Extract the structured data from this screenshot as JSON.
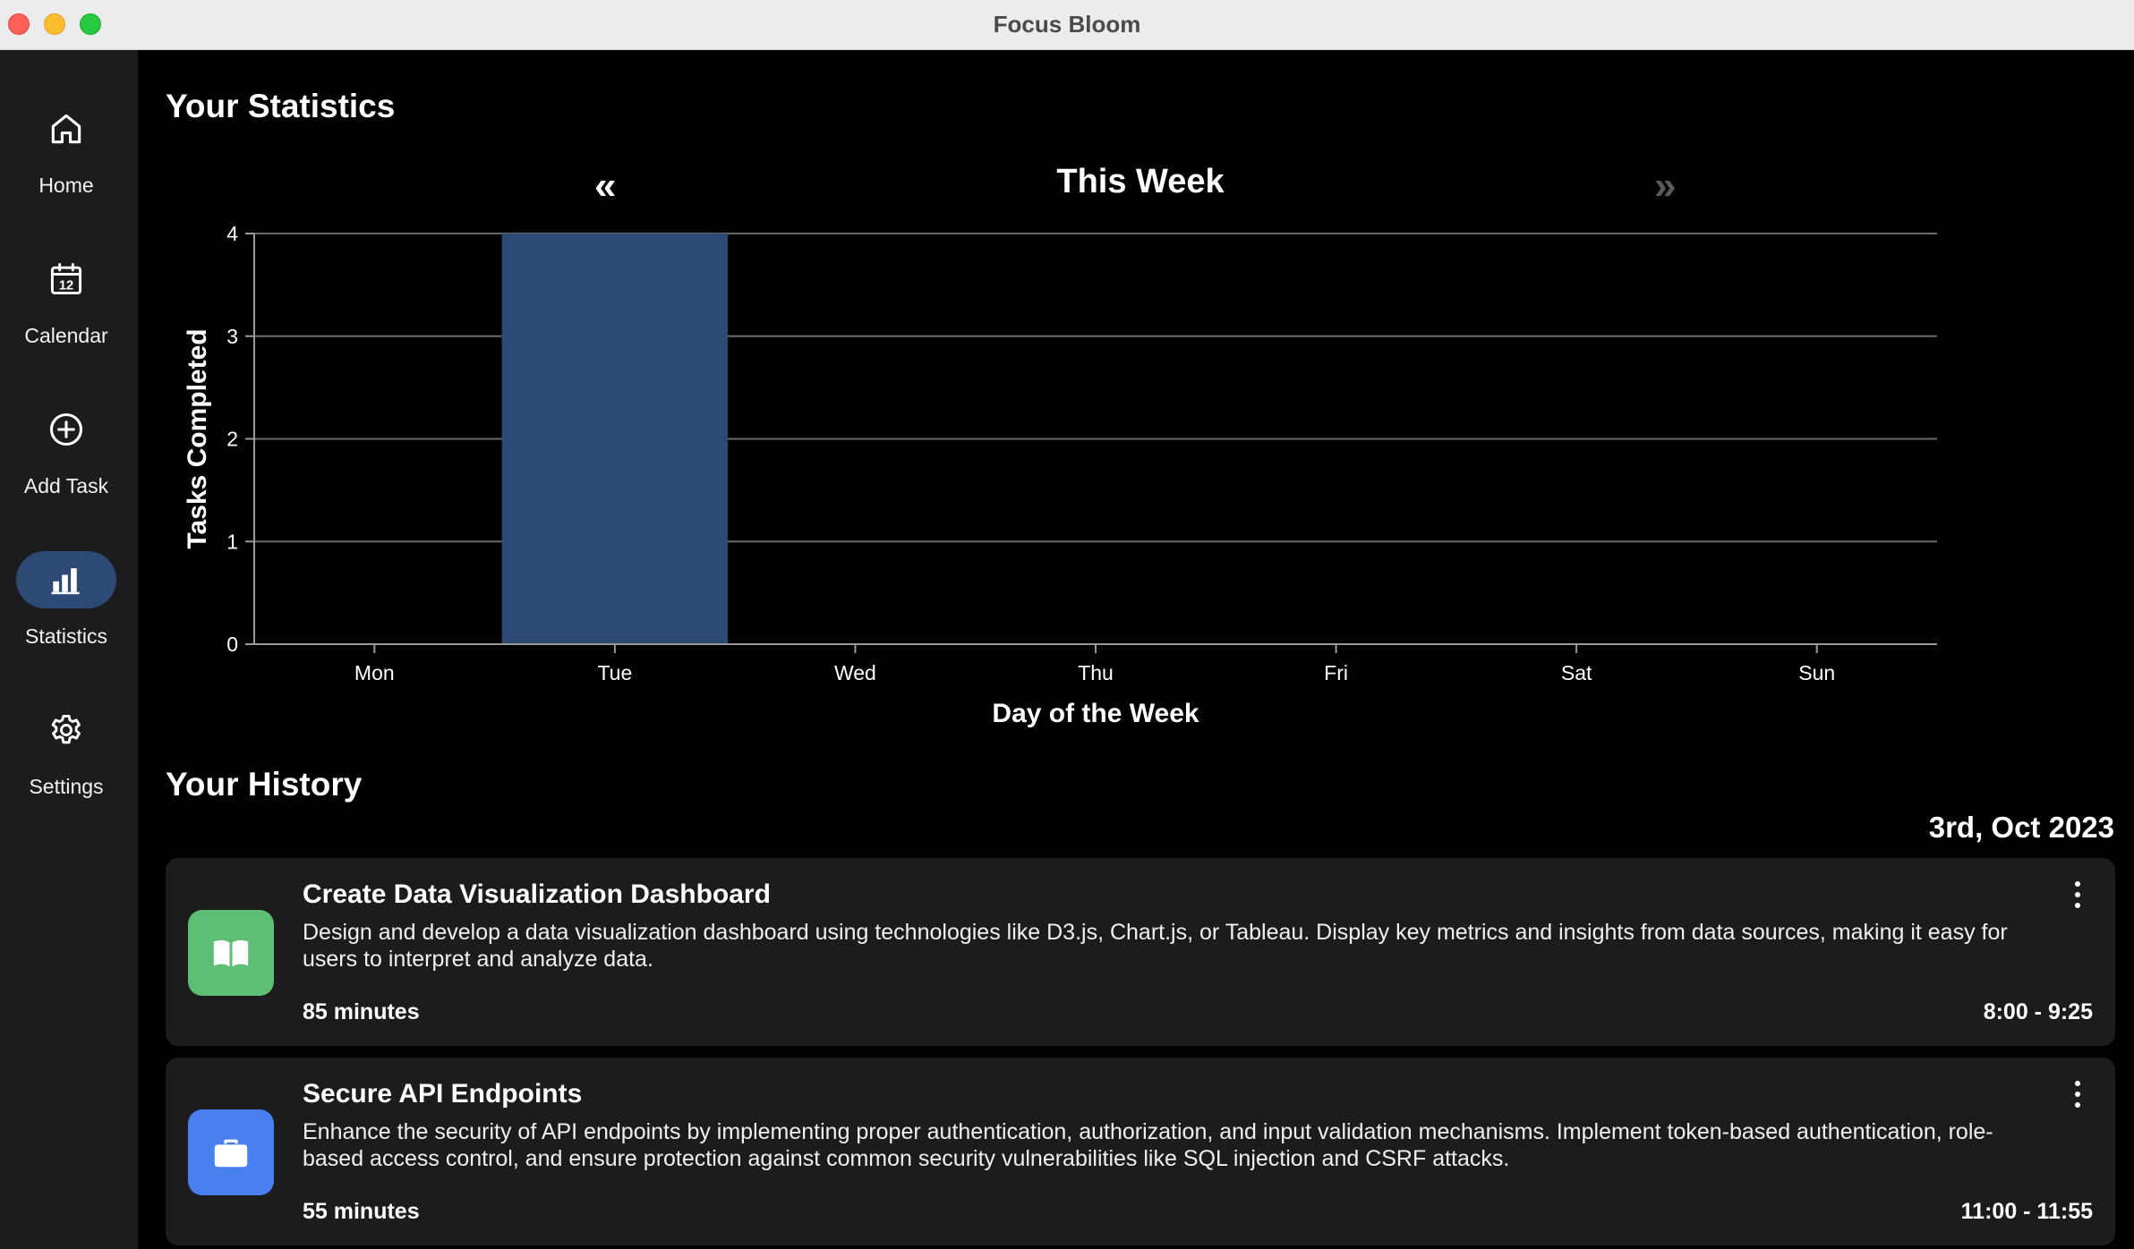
{
  "window": {
    "title": "Focus Bloom"
  },
  "sidebar": {
    "items": [
      {
        "label": "Home",
        "icon": "home-icon",
        "active": false
      },
      {
        "label": "Calendar",
        "icon": "calendar-icon",
        "active": false,
        "calendar_day": "12"
      },
      {
        "label": "Add Task",
        "icon": "add-circle-icon",
        "active": false
      },
      {
        "label": "Statistics",
        "icon": "bar-chart-icon",
        "active": true
      },
      {
        "label": "Settings",
        "icon": "gear-icon",
        "active": false
      }
    ],
    "active_color": "#2c4a74"
  },
  "statistics": {
    "title": "Your Statistics",
    "week_label": "This Week",
    "prev_label": "«",
    "next_label": "»"
  },
  "chart_data": {
    "type": "bar",
    "categories": [
      "Mon",
      "Tue",
      "Wed",
      "Thu",
      "Fri",
      "Sat",
      "Sun"
    ],
    "values": [
      0,
      4,
      0,
      0,
      0,
      0,
      0
    ],
    "xlabel": "Day of the Week",
    "ylabel": "Tasks Completed",
    "ylim": [
      0,
      4
    ],
    "yticks": [
      0,
      1,
      2,
      3,
      4
    ],
    "grid": true,
    "bar_color": "#2c4a74"
  },
  "history": {
    "title": "Your History",
    "date": "3rd, Oct 2023",
    "tasks": [
      {
        "title": "Create Data Visualization Dashboard",
        "description": "Design and develop a data visualization dashboard using technologies like D3.js, Chart.js, or Tableau. Display key metrics and insights from data sources, making it easy for users to interpret and analyze data.",
        "duration": "85 minutes",
        "time": "8:00 - 9:25",
        "icon": "book-icon",
        "icon_color": "#5cbf73"
      },
      {
        "title": "Secure API Endpoints",
        "description": "Enhance the security of API endpoints by implementing proper authentication, authorization, and input validation mechanisms. Implement token-based authentication, role-based access control, and ensure protection against common security vulnerabilities like SQL injection and CSRF attacks.",
        "duration": "55 minutes",
        "time": "11:00 - 11:55",
        "icon": "briefcase-icon",
        "icon_color": "#4a7ff0"
      }
    ]
  }
}
